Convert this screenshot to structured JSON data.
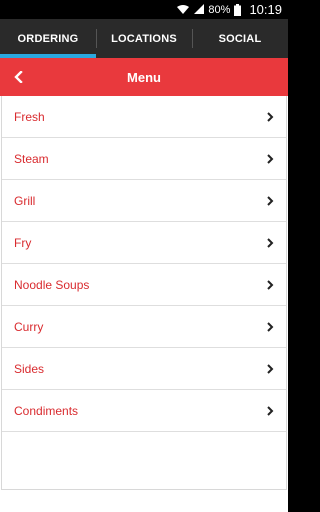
{
  "statusbar": {
    "battery_text": "80%",
    "time": "10:19",
    "icons": [
      "wifi-icon",
      "signal-icon",
      "battery-icon"
    ]
  },
  "tabs": [
    {
      "label": "ORDERING",
      "active": true
    },
    {
      "label": "LOCATIONS",
      "active": false
    },
    {
      "label": "SOCIAL",
      "active": false
    }
  ],
  "header": {
    "title": "Menu",
    "back_icon": "chevron-left-icon",
    "color": "#e9393d"
  },
  "menu": {
    "items": [
      {
        "label": "Fresh"
      },
      {
        "label": "Steam"
      },
      {
        "label": "Grill"
      },
      {
        "label": "Fry"
      },
      {
        "label": "Noodle Soups"
      },
      {
        "label": "Curry"
      },
      {
        "label": "Sides"
      },
      {
        "label": "Condiments"
      }
    ],
    "item_icon": "chevron-right-icon",
    "label_color": "#d92b2f"
  },
  "colors": {
    "accent_tab_indicator": "#2aa8e0",
    "tab_bar": "#2a2a2a"
  }
}
